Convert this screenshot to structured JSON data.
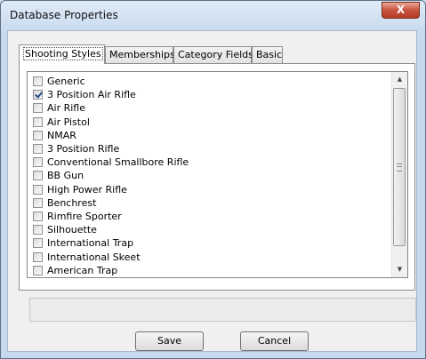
{
  "window": {
    "title": "Database Properties"
  },
  "tabs": [
    {
      "label": "Shooting Styles",
      "active": true
    },
    {
      "label": "Memberships",
      "active": false
    },
    {
      "label": "Category Fields",
      "active": false
    },
    {
      "label": "Basic",
      "active": false
    }
  ],
  "shooting_styles": [
    {
      "label": "Generic",
      "checked": false
    },
    {
      "label": "3 Position Air Rifle",
      "checked": true
    },
    {
      "label": "Air Rifle",
      "checked": false
    },
    {
      "label": "Air Pistol",
      "checked": false
    },
    {
      "label": "NMAR",
      "checked": false
    },
    {
      "label": "3 Position Rifle",
      "checked": false
    },
    {
      "label": "Conventional Smallbore Rifle",
      "checked": false
    },
    {
      "label": "BB Gun",
      "checked": false
    },
    {
      "label": "High Power Rifle",
      "checked": false
    },
    {
      "label": "Benchrest",
      "checked": false
    },
    {
      "label": "Rimfire Sporter",
      "checked": false
    },
    {
      "label": "Silhouette",
      "checked": false
    },
    {
      "label": "International Trap",
      "checked": false
    },
    {
      "label": "International Skeet",
      "checked": false
    },
    {
      "label": "American Trap",
      "checked": false
    }
  ],
  "buttons": {
    "save": "Save",
    "cancel": "Cancel"
  },
  "icons": {
    "close": "X",
    "scroll_up": "▲",
    "scroll_down": "▼"
  }
}
